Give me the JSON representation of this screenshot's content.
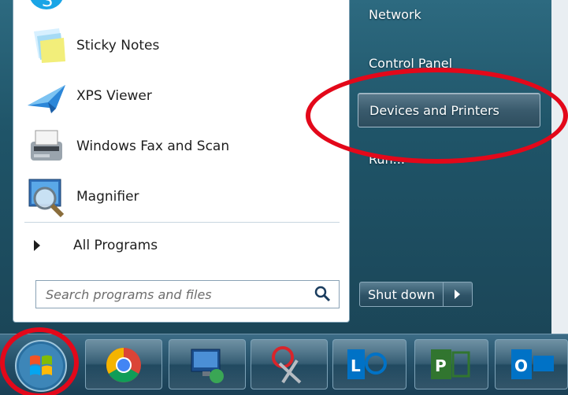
{
  "start_menu": {
    "programs": [
      {
        "label": "Sticky Notes",
        "icon": "sticky-notes-icon"
      },
      {
        "label": "XPS Viewer",
        "icon": "xps-viewer-icon"
      },
      {
        "label": "Windows Fax and Scan",
        "icon": "fax-scan-icon"
      },
      {
        "label": "Magnifier",
        "icon": "magnifier-icon"
      }
    ],
    "all_programs": "All Programs",
    "search": {
      "placeholder": "Search programs and files"
    },
    "right": {
      "network": "Network",
      "control_panel": "Control Panel",
      "devices_printers": "Devices and Printers",
      "run": "Run..."
    },
    "shutdown": "Shut down"
  },
  "taskbar": {
    "items": [
      "start-orb",
      "chrome",
      "remote-desktop",
      "snipping-tool",
      "lync",
      "project",
      "outlook"
    ]
  },
  "colors": {
    "annotation": "#e3081a",
    "accent": "#1f5468"
  }
}
